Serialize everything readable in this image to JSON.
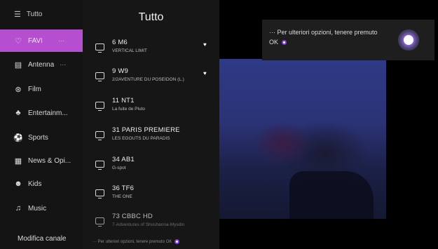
{
  "sidebar": {
    "header": {
      "icon": "menu-icon",
      "label": "Tutto"
    },
    "items": [
      {
        "icon": "heart-icon",
        "label": "FAVI",
        "dots": "···"
      },
      {
        "icon": "antenna-icon",
        "label": "Antenna",
        "dots": "···"
      },
      {
        "icon": "film-icon",
        "label": "Film"
      },
      {
        "icon": "entertainment-icon",
        "label": "Entertainm..."
      },
      {
        "icon": "sports-icon",
        "label": "Sports"
      },
      {
        "icon": "news-icon",
        "label": "News & Opi..."
      },
      {
        "icon": "kids-icon",
        "label": "Kids"
      },
      {
        "icon": "music-icon",
        "label": "Music"
      }
    ],
    "footer": "Modifica canale"
  },
  "channel_list": {
    "title": "Tutto",
    "channels": [
      {
        "name": "6 M6",
        "program": "VERTICAL LIMIT",
        "favorite": true
      },
      {
        "name": "9 W9",
        "program": "2/2AVENTURE DU POSEIDON (L.)",
        "favorite": true
      },
      {
        "name": "11 NT1",
        "program": "La fuite de Pluto",
        "favorite": false
      },
      {
        "name": "31 PARIS PREMIERE",
        "program": "LES EGOUTS DU PARADIS",
        "favorite": false
      },
      {
        "name": "34 AB1",
        "program": "G-spot",
        "favorite": false
      },
      {
        "name": "36 TF6",
        "program": "THE ONE",
        "favorite": false
      },
      {
        "name": "73 CBBC HD",
        "program": "7-Adventures of Shoshanna-Mysdin",
        "favorite": false
      }
    ],
    "hint": "··· Per ulteriori opzioni, tenere premuto OK"
  },
  "popup": {
    "text": "··· Per ulteriori opzioni, tenere premuto OK"
  },
  "colors": {
    "accent": "#b54fd0",
    "ok_button": "#7b3ee0"
  }
}
